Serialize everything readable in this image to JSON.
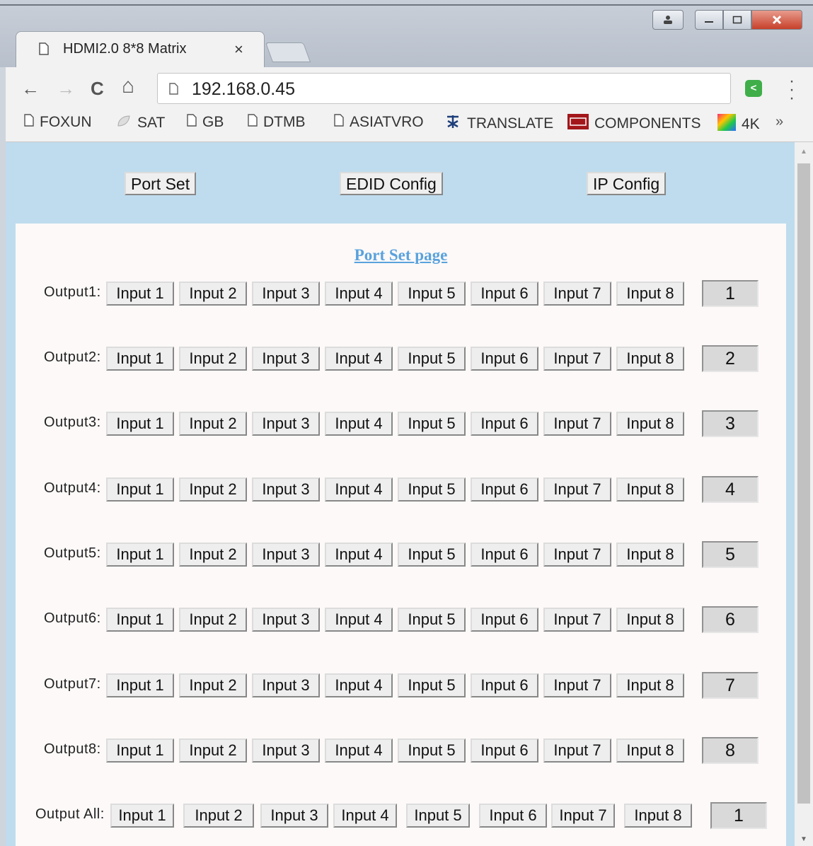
{
  "browser": {
    "tab_title": "HDMI2.0 8*8 Matrix",
    "tab_close": "×",
    "url": "192.168.0.45",
    "nav": {
      "back": "←",
      "forward": "→",
      "reload": "C",
      "home": "⌂"
    },
    "bookmarks": [
      {
        "label": "FOXUN",
        "icon": "page-icon"
      },
      {
        "label": "SAT",
        "icon": "leaf-icon"
      },
      {
        "label": "GB",
        "icon": "page-icon"
      },
      {
        "label": "DTMB",
        "icon": "page-icon"
      },
      {
        "label": "ASIATVRO",
        "icon": "page-icon"
      },
      {
        "label": "TRANSLATE",
        "icon": "translate-icon"
      },
      {
        "label": "COMPONENTS",
        "icon": "components-icon"
      },
      {
        "label": "4K",
        "icon": "color-square-icon"
      }
    ],
    "bookmarks_more": "»"
  },
  "nav_buttons": {
    "port_set": "Port Set",
    "edid_config": "EDID Config",
    "ip_config": "IP Config"
  },
  "page_title": "Port Set page",
  "inputs": [
    "Input 1",
    "Input 2",
    "Input 3",
    "Input 4",
    "Input 5",
    "Input 6",
    "Input 7",
    "Input 8"
  ],
  "outputs": [
    {
      "label": "Output1:",
      "value": "1"
    },
    {
      "label": "Output2:",
      "value": "2"
    },
    {
      "label": "Output3:",
      "value": "3"
    },
    {
      "label": "Output4:",
      "value": "4"
    },
    {
      "label": "Output5:",
      "value": "5"
    },
    {
      "label": "Output6:",
      "value": "6"
    },
    {
      "label": "Output7:",
      "value": "7"
    },
    {
      "label": "Output8:",
      "value": "8"
    }
  ],
  "output_all": {
    "label": "Output All:",
    "value": "1"
  },
  "colors": {
    "page_bg": "#bfdcee",
    "panel_bg": "#fcf9f8",
    "title_link": "#5aa2dd"
  }
}
